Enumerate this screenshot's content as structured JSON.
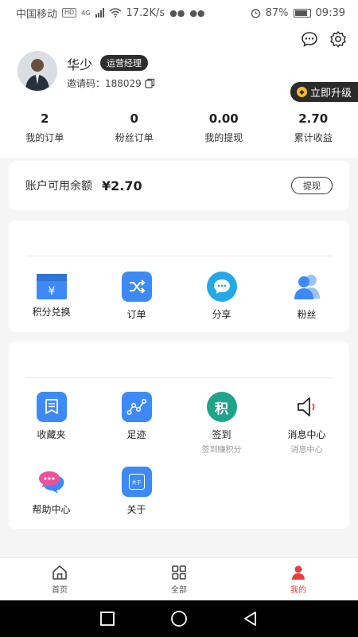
{
  "status_bar": {
    "carrier": "中国移动",
    "hd": "HD",
    "net": "4G",
    "speed": "17.2K/s",
    "battery": "87%",
    "time": "09:39"
  },
  "profile": {
    "name": "华少",
    "role": "运营经理",
    "invite_code": "邀请码：188029",
    "upgrade_label": "立即升级"
  },
  "stats": [
    {
      "value": "2",
      "label": "我的订单"
    },
    {
      "value": "0",
      "label": "粉丝订单"
    },
    {
      "value": "0.00",
      "label": "我的提现"
    },
    {
      "value": "2.70",
      "label": "累计收益"
    }
  ],
  "balance": {
    "label": "账户可用余额",
    "amount": "¥2.70",
    "withdraw_label": "提现"
  },
  "section1": [
    {
      "label": "积分兑换",
      "icon": "exchange-icon"
    },
    {
      "label": "订单",
      "icon": "shuffle-icon"
    },
    {
      "label": "分享",
      "icon": "chat-share-icon"
    },
    {
      "label": "粉丝",
      "icon": "fans-icon"
    }
  ],
  "section2": [
    {
      "label": "收藏夹",
      "sub": "",
      "icon": "bookmark-icon"
    },
    {
      "label": "足迹",
      "sub": "",
      "icon": "footprint-icon"
    },
    {
      "label": "签到",
      "sub": "签到赚积分",
      "icon": "checkin-icon",
      "glyph": "积"
    },
    {
      "label": "消息中心",
      "sub": "消息中心",
      "icon": "speaker-icon"
    },
    {
      "label": "帮助中心",
      "sub": "",
      "icon": "help-chat-icon"
    },
    {
      "label": "关于",
      "sub": "",
      "icon": "about-icon",
      "glyph": "关于"
    }
  ],
  "tabs": [
    {
      "label": "首页",
      "icon": "home-icon"
    },
    {
      "label": "全部",
      "icon": "grid-icon"
    },
    {
      "label": "我的",
      "icon": "person-icon"
    }
  ],
  "colors": {
    "accent": "#e8403f",
    "blue": "#3d8af7",
    "teal": "#1fa38a",
    "dark_badge": "#2e2e2e"
  }
}
